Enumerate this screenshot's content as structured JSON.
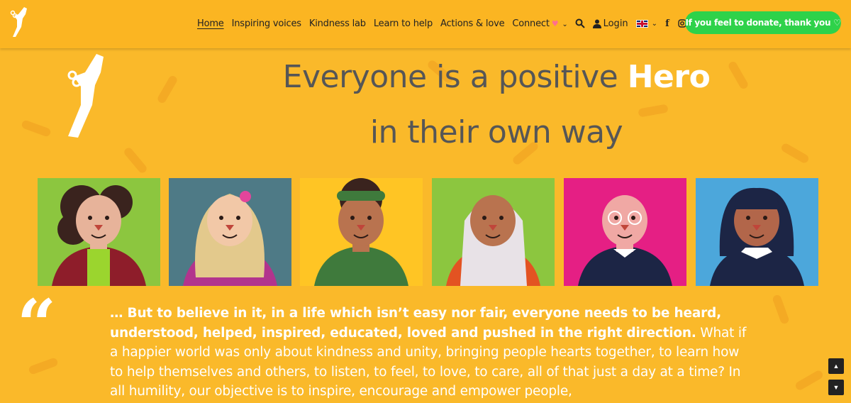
{
  "nav": {
    "items": [
      {
        "label": "Home",
        "active": true
      },
      {
        "label": "Inspiring voices"
      },
      {
        "label": "Kindness lab"
      },
      {
        "label": "Learn to help"
      },
      {
        "label": "Actions & love"
      },
      {
        "label": "Connect"
      }
    ],
    "login_label": "Login",
    "donate_label": "If you feel to donate, thank you ♡"
  },
  "hero": {
    "line1_prefix": "Everyone is a positive ",
    "line1_highlight": "Hero",
    "line2": "in their own way"
  },
  "portraits": [
    {
      "name": "portrait-woman-curly-hair",
      "bg": "#8CC63F",
      "skin": "#E7B39A",
      "hair": "#3A231E",
      "shirt": "#8E1D2A",
      "accent": "#9BD52E"
    },
    {
      "name": "portrait-blonde-woman",
      "bg": "#4E7A86",
      "skin": "#F2C8A7",
      "hair": "#E3C98C",
      "shirt": "#B2348D",
      "accent": "#E3459B"
    },
    {
      "name": "portrait-man-headband",
      "bg": "#FFC524",
      "skin": "#B9734F",
      "hair": "#3A231E",
      "shirt": "#3F7A3C",
      "accent": "#3F7A3C"
    },
    {
      "name": "portrait-woman-hijab",
      "bg": "#8CC63F",
      "skin": "#B9734F",
      "hair": "#E8E2E7",
      "shirt": "#E35322",
      "accent": "#E8E2E7"
    },
    {
      "name": "portrait-bald-man-glasses",
      "bg": "#E51F84",
      "skin": "#F0A8A4",
      "hair": "#E7C8C0",
      "shirt": "#1C2545",
      "accent": "#ffffff"
    },
    {
      "name": "portrait-girl-bangs",
      "bg": "#4CA7DB",
      "skin": "#B2664A",
      "hair": "#1C2545",
      "shirt": "#1C2545",
      "accent": "#ffffff"
    }
  ],
  "quote": {
    "bold_text": "… But to believe in it, in a life which isn’t easy nor fair, everyone needs to be heard, understood, helped, inspired, educated, loved and pushed in the right direction.",
    "regular_text": " What if a happier world was only about kindness and unity, bringing people hearts together, to learn how to help themselves and others, to listen, to feel, to love, to care, all of that just a day at a time? In all humility, our objective is to inspire, encourage and empower people,"
  },
  "colors": {
    "background": "#FAB92A",
    "donate": "#2ED24A",
    "headline": "#565656",
    "highlight": "#FFFFFF"
  },
  "icons": {
    "search": "search-icon",
    "user": "user-icon",
    "flag": "uk-flag-icon",
    "facebook": "facebook-icon",
    "instagram": "instagram-icon",
    "scroll_up": "arrow-up-icon",
    "scroll_down": "arrow-down-icon"
  }
}
